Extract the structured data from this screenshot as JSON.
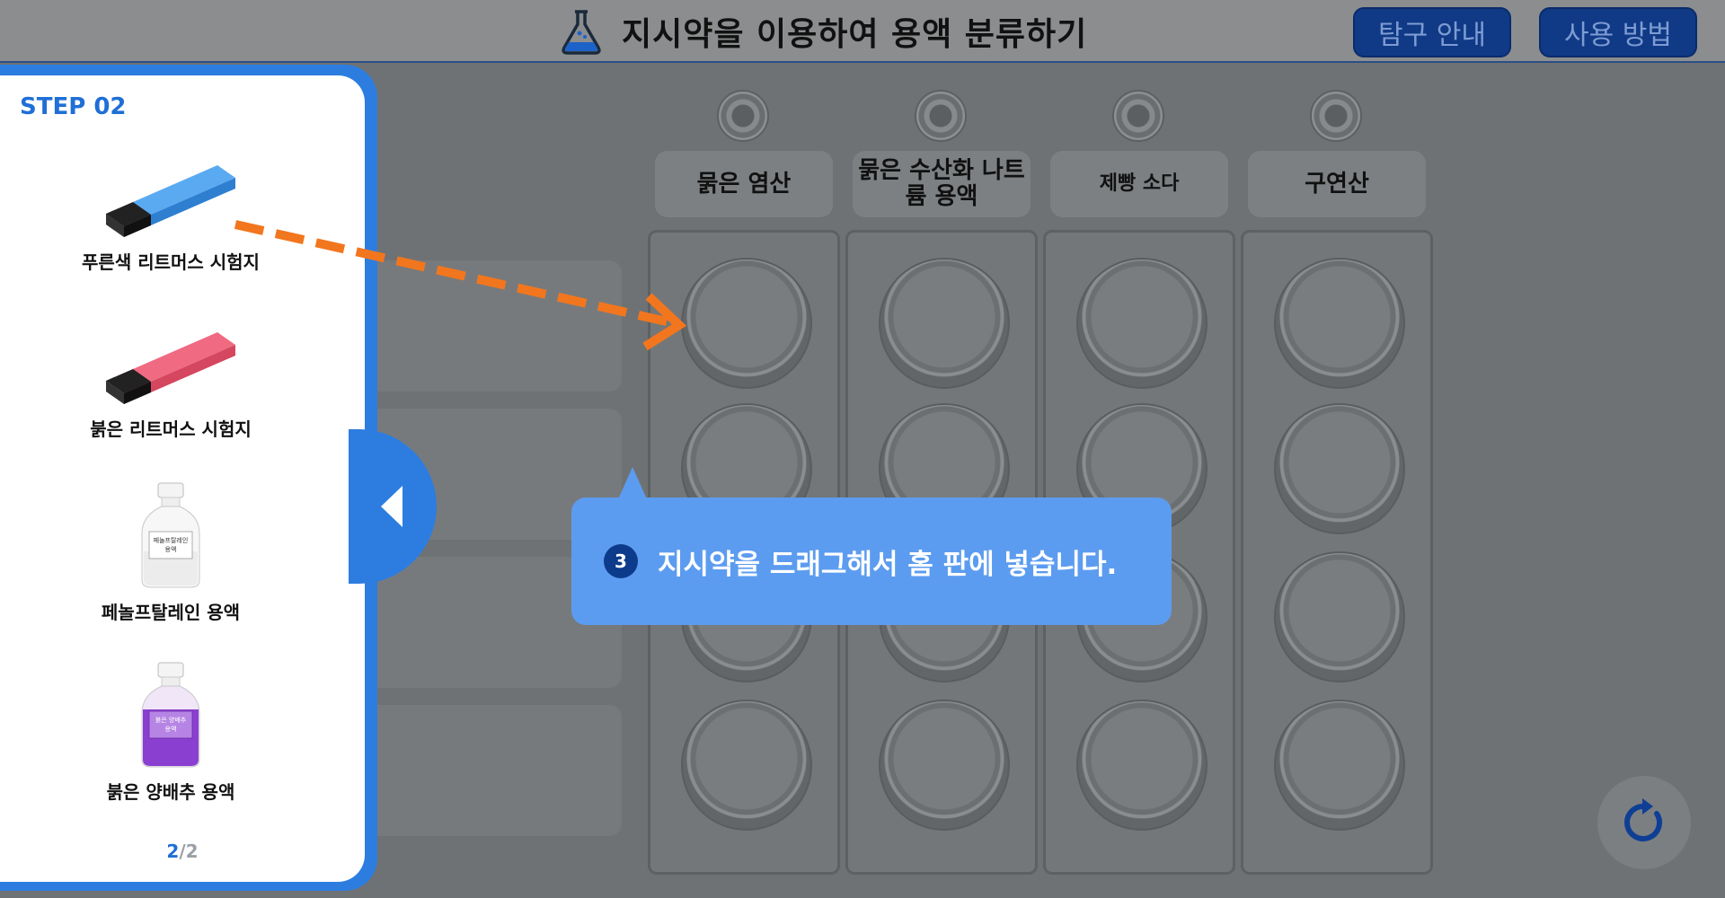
{
  "header": {
    "title": "지시약을 이용하여 용액 분류하기",
    "title_icon": "flask-icon",
    "buttons": [
      {
        "label": "탐구 안내"
      },
      {
        "label": "사용 방법"
      }
    ]
  },
  "sidebar": {
    "step_label": "STEP 02",
    "tools": [
      {
        "label": "푸른색 리트머스 시험지",
        "icon": "blue-litmus-paper-icon",
        "color": "#5aaaf2"
      },
      {
        "label": "붉은 리트머스 시험지",
        "icon": "red-litmus-paper-icon",
        "color": "#f06a82"
      },
      {
        "label": "페놀프탈레인 용액",
        "icon": "phenolphthalein-bottle-icon",
        "bottle_label": "페놀프탈레인 용액",
        "color": "#f4f4f4"
      },
      {
        "label": "붉은 양배추 용액",
        "icon": "red-cabbage-bottle-icon",
        "bottle_label": "붉은 양배추 용액",
        "color": "#8a3fd0"
      }
    ],
    "pager": {
      "current": "2",
      "separator": "/",
      "total": "2"
    },
    "collapse_icon": "chevron-left-icon"
  },
  "columns": [
    {
      "label": "묽은 염산"
    },
    {
      "label": "묽은 수산화 나트륨 용액"
    },
    {
      "label": "제빵 소다"
    },
    {
      "label": "구연산"
    }
  ],
  "tooltip": {
    "step_number": "3",
    "text": "지시약을 드래그해서 홈 판에 넣습니다."
  },
  "colors": {
    "accent": "#2d7de0",
    "header_button": "#103a86",
    "drag_arrow": "#f2761e",
    "tooltip": "#5c9cf0"
  },
  "reset_icon": "refresh-icon"
}
